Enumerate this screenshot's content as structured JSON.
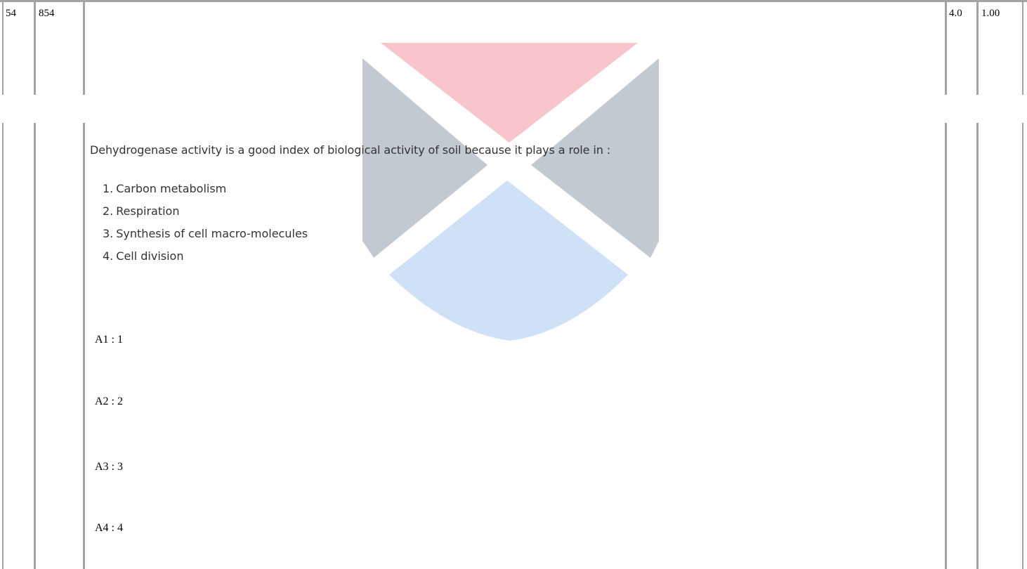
{
  "row": {
    "serial": "54",
    "question_id": "854",
    "marks": "4.0",
    "negative": "1.00"
  },
  "question": {
    "stem": "Dehydrogenase activity is a good index of biological activity of soil because it plays a role in :",
    "options": [
      {
        "num": "1.",
        "text": "Carbon metabolism"
      },
      {
        "num": "2.",
        "text": "Respiration"
      },
      {
        "num": "3.",
        "text": "Synthesis of cell macro-molecules"
      },
      {
        "num": "4.",
        "text": "Cell division"
      }
    ]
  },
  "answers": [
    {
      "label": "A1 :",
      "value": "1"
    },
    {
      "label": "A2 :",
      "value": "2"
    },
    {
      "label": "A3 :",
      "value": "3"
    },
    {
      "label": "A4 :",
      "value": "4"
    }
  ],
  "colors": {
    "table_border": "#a3a3a3",
    "watermark_red": "#f7c5cb",
    "watermark_gray": "#c3c9d1",
    "watermark_blue": "#cfe1f7",
    "question_text": "#333333"
  }
}
